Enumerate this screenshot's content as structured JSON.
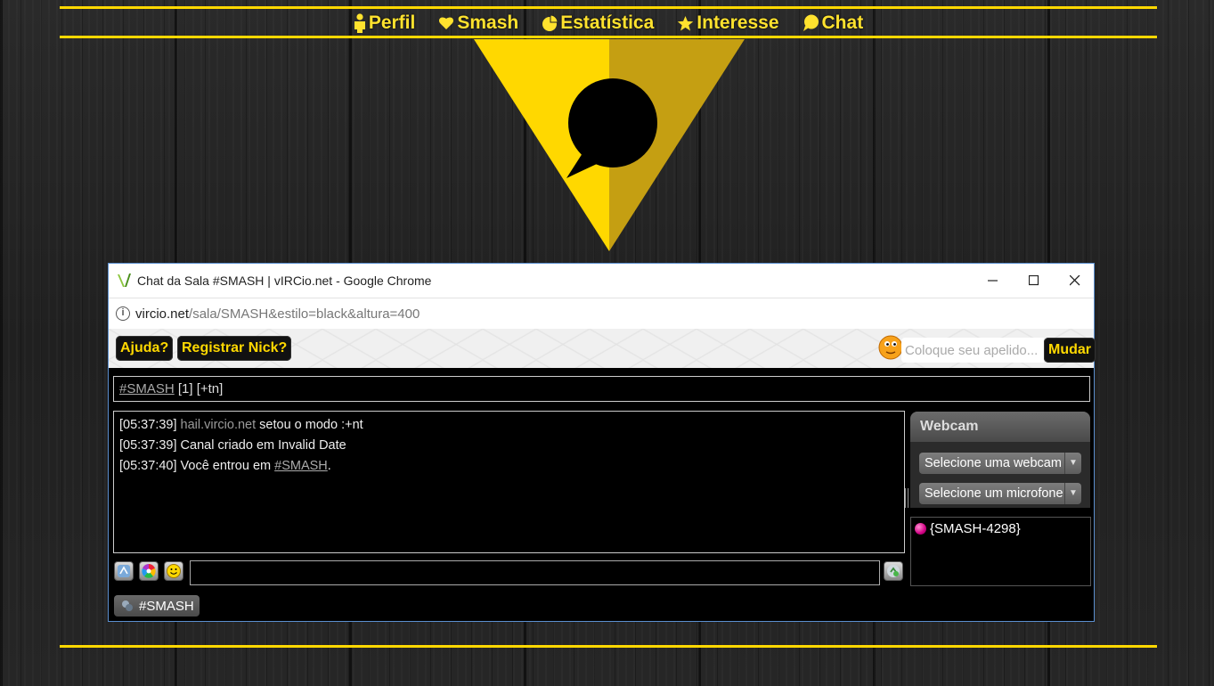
{
  "nav": {
    "items": [
      {
        "label": "Perfil",
        "icon": "person-icon"
      },
      {
        "label": "Smash",
        "icon": "heart-icon"
      },
      {
        "label": "Estatística",
        "icon": "pie-chart-icon"
      },
      {
        "label": "Interesse",
        "icon": "star-icon"
      },
      {
        "label": "Chat",
        "icon": "speech-bubble-icon"
      }
    ]
  },
  "colors": {
    "accent": "#ffd800",
    "accent_dark": "#c59f12",
    "window_border": "#5b8fcf"
  },
  "window": {
    "title": "Chat da Sala #SMASH | vIRCio.net - Google Chrome",
    "url_host": "vircio.net",
    "url_path": "/sala/SMASH&estilo=black&altura=400"
  },
  "toolbar": {
    "help_label": "Ajuda?",
    "register_label": "Registrar Nick?",
    "nick_placeholder": "Coloque seu apelido...",
    "change_label": "Mudar"
  },
  "channel": {
    "name": "#SMASH",
    "info": " [1] [+tn]"
  },
  "messages": [
    {
      "time": "[05:37:39]",
      "host": "hail.vircio.net",
      "text": " setou o modo :+nt"
    },
    {
      "time": "[05:37:39]",
      "text": " Canal criado em Invalid Date"
    },
    {
      "time": "[05:37:40]",
      "text": " Você entrou em ",
      "link": "#SMASH",
      "suffix": "."
    }
  ],
  "webcam": {
    "title": "Webcam",
    "select_webcam": "Selecione uma webcam",
    "select_mic": "Selecione um microfone"
  },
  "users": [
    {
      "nick": "{SMASH-4298}"
    }
  ],
  "tab": {
    "label": "#SMASH"
  }
}
